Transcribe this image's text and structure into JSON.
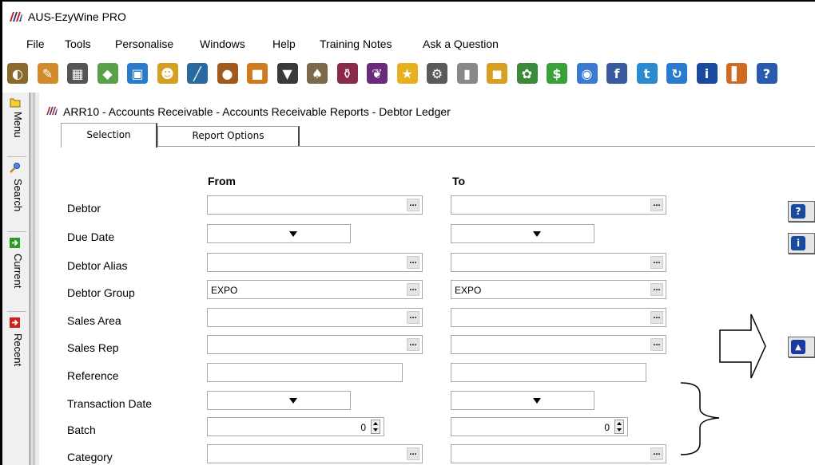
{
  "app": {
    "title": "AUS-EzyWine PRO"
  },
  "menu": [
    "File",
    "Tools",
    "Personalise",
    "Windows",
    "Help",
    "Training Notes",
    "Ask a Question"
  ],
  "toolbar": {
    "icons": [
      {
        "name": "wine-barrel-icon",
        "color": "#8a6a2a"
      },
      {
        "name": "edit-document-icon",
        "color": "#d28a2a"
      },
      {
        "name": "building-icon",
        "color": "#555555"
      },
      {
        "name": "tag-icon",
        "color": "#5aa04a"
      },
      {
        "name": "window-icon",
        "color": "#2a7acc"
      },
      {
        "name": "users-icon",
        "color": "#d4a020"
      },
      {
        "name": "wrench-icon",
        "color": "#2a6aa0"
      },
      {
        "name": "cask-icon",
        "color": "#a05a20"
      },
      {
        "name": "box-icon",
        "color": "#d07a20"
      },
      {
        "name": "glass-icon",
        "color": "#3a3a3a"
      },
      {
        "name": "bottle-icon",
        "color": "#7a6a4a"
      },
      {
        "name": "wine-bottle-icon",
        "color": "#8a2a4a"
      },
      {
        "name": "grapes-icon",
        "color": "#6a2a7a"
      },
      {
        "name": "star-icon",
        "color": "#e8b020"
      },
      {
        "name": "gear-icon",
        "color": "#5a5a5a"
      },
      {
        "name": "tank-icon",
        "color": "#888888"
      },
      {
        "name": "package-icon",
        "color": "#d8a020"
      },
      {
        "name": "vine-icon",
        "color": "#3a8a3a"
      },
      {
        "name": "dollar-icon",
        "color": "#3aa03a"
      },
      {
        "name": "globe-icon",
        "color": "#3a7ad0"
      },
      {
        "name": "facebook-icon",
        "color": "#3a5aa0"
      },
      {
        "name": "twitter-icon",
        "color": "#2a8ad0"
      },
      {
        "name": "refresh-icon",
        "color": "#2a7ad0"
      },
      {
        "name": "info-icon",
        "color": "#1a4aa0"
      },
      {
        "name": "bookmark-icon",
        "color": "#d06a20"
      },
      {
        "name": "help-icon",
        "color": "#2a5ab0"
      }
    ]
  },
  "sidebar": [
    {
      "label": "Menu",
      "icon": "folder-icon",
      "color": "#e8c020"
    },
    {
      "label": "Search",
      "icon": "search-icon",
      "color": "#d0a030"
    },
    {
      "label": "Current",
      "icon": "arrow-right-icon",
      "color": "#2a9a2a"
    },
    {
      "label": "Recent",
      "icon": "arrow-right-icon",
      "color": "#d02020"
    }
  ],
  "document": {
    "title": "ARR10 - Accounts Receivable - Accounts Receivable Reports - Debtor Ledger"
  },
  "tabs": [
    "Selection",
    "Report Options"
  ],
  "form": {
    "from_header": "From",
    "to_header": "To",
    "rows": [
      {
        "label": "Debtor",
        "type": "lookup",
        "from": "",
        "to": ""
      },
      {
        "label": "Due Date",
        "type": "date",
        "from": "",
        "to": ""
      },
      {
        "label": "Debtor Alias",
        "type": "lookup",
        "from": "",
        "to": ""
      },
      {
        "label": "Debtor Group",
        "type": "lookup",
        "from": "EXPO",
        "to": "EXPO"
      },
      {
        "label": "Sales Area",
        "type": "lookup",
        "from": "",
        "to": ""
      },
      {
        "label": "Sales Rep",
        "type": "lookup",
        "from": "",
        "to": ""
      },
      {
        "label": "Reference",
        "type": "text",
        "from": "",
        "to": ""
      },
      {
        "label": "Transaction Date",
        "type": "date",
        "from": "",
        "to": ""
      },
      {
        "label": "Batch",
        "type": "spin",
        "from": "0",
        "to": "0"
      },
      {
        "label": "Category",
        "type": "lookup",
        "from": "",
        "to": ""
      }
    ],
    "ellipsis": "..."
  },
  "actions": [
    {
      "name": "help-button",
      "icon": "question-icon",
      "glyph": "?",
      "color": "#1a4aa0"
    },
    {
      "name": "info-button",
      "icon": "info-icon",
      "glyph": "i",
      "color": "#1a4aa0"
    },
    {
      "name": "scroll-up-button",
      "icon": "triangle-up-icon",
      "glyph": "▲",
      "color": "#1a3aa0"
    }
  ]
}
